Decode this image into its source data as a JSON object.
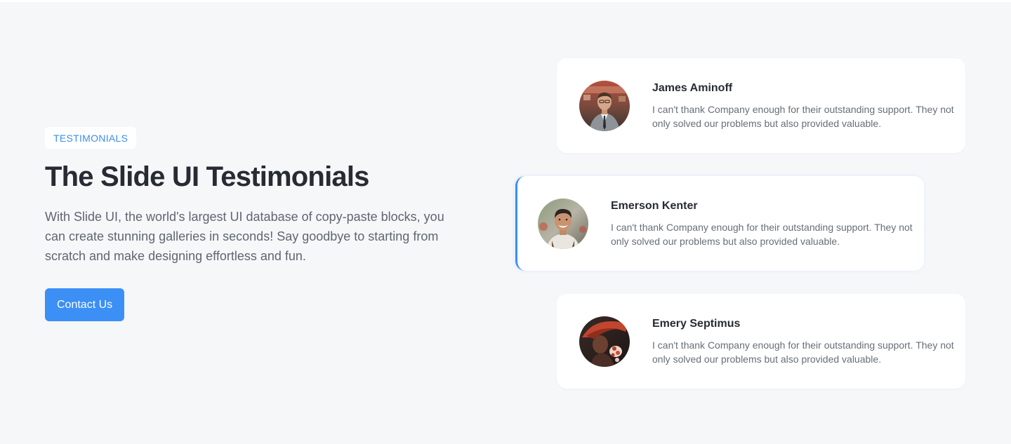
{
  "hero": {
    "badge": "TESTIMONIALS",
    "title": "The Slide UI Testimonials",
    "description": "With Slide UI, the world's largest UI database of copy-paste blocks, you can create stunning galleries in seconds! Say goodbye to starting from scratch and make designing effortless and fun.",
    "cta_label": "Contact Us"
  },
  "testimonials": [
    {
      "name": "James Aminoff",
      "quote": "I can't thank Company enough for their outstanding support. They not only solved our problems but also provided valuable.",
      "avatar_icon": "person-photo-avatar"
    },
    {
      "name": "Emerson Kenter",
      "quote": "I can't thank Company enough for their outstanding support. They not only solved our problems but also provided valuable.",
      "avatar_icon": "person-photo-avatar"
    },
    {
      "name": "Emery Septimus",
      "quote": "I can't thank Company enough for their outstanding support. They not only solved our problems but also provided valuable.",
      "avatar_icon": "person-photo-avatar"
    }
  ],
  "colors": {
    "accent": "#3b8ff5",
    "background": "#f6f7f9",
    "heading": "#272b33",
    "body_text": "#5f6670"
  }
}
